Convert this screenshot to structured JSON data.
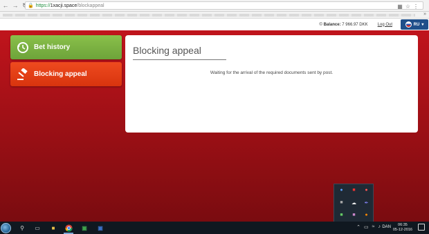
{
  "browser": {
    "url_scheme": "https://",
    "url_host": "1xacji.space",
    "url_path": "/blockappeal"
  },
  "header": {
    "balance_label": "Balance:",
    "balance_value": "7 966.97 DKK",
    "logout": "Log Out",
    "language": "RU"
  },
  "menu": {
    "items": [
      {
        "label": "Bet history",
        "icon": "history-icon",
        "color": "#7cb342"
      },
      {
        "label": "Blocking appeal",
        "icon": "gavel-icon",
        "color": "#e8401a"
      }
    ]
  },
  "panel": {
    "title": "Blocking appeal",
    "message": "Waiting for the arrival of the required documents sent by post."
  },
  "taskbar": {
    "input_lang": "DAN",
    "time": "06:35",
    "date": "05-12-2016"
  },
  "colors": {
    "background_red": "#b3131a",
    "header_blue": "#1f4f8a",
    "green_button": "#7cb342",
    "orange_button": "#e8401a"
  }
}
